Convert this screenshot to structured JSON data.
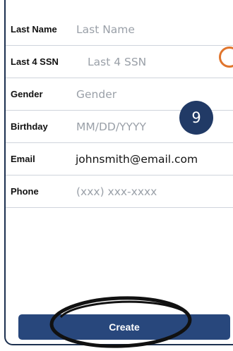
{
  "form": {
    "fields": [
      {
        "label": "Last Name",
        "placeholder": "Last Name"
      },
      {
        "label": "Last 4 SSN",
        "placeholder": "Last 4 SSN"
      },
      {
        "label": "Gender",
        "placeholder": "Gender"
      },
      {
        "label": "Birthday",
        "placeholder": "MM/DD/YYYY"
      },
      {
        "label": "Email",
        "value": "johnsmith@email.com"
      },
      {
        "label": "Phone",
        "placeholder": "(xxx) xxx-xxxx"
      }
    ],
    "create_label": "Create"
  },
  "annotations": {
    "step_number": "9"
  },
  "colors": {
    "accent": "#28477c",
    "badge": "#213a66",
    "marker": "#e0752d",
    "frame": "#1d3150"
  }
}
